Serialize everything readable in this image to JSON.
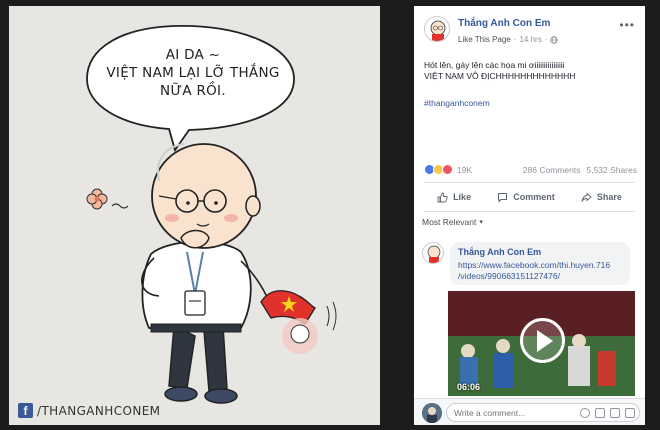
{
  "artwork": {
    "speech_lines": [
      "AI DA ~",
      "VIỆT NAM LẠI LỠ THẮNG",
      "NỮA RỒI."
    ],
    "watermark_logo": "f",
    "watermark_text": "/THANGANHCONEM"
  },
  "post": {
    "page_name": "Thắng Anh Con Em",
    "like_page": "Like This Page",
    "separator": "·",
    "time": "14 hrs",
    "separator2": "·",
    "more": "•••",
    "text_line1": "Hót lên, gáy lên các họa mi ơiiiiiiiiiiiiiiii",
    "text_line2": "VIỆT NAM VÔ ĐỊCHHHHHHHHHHHHH",
    "hashtag": "#thanganhconem",
    "reactions_count": "19K",
    "comments_count": "286 Comments",
    "shares_count": "5,532 Shares",
    "actions": {
      "like": "Like",
      "comment": "Comment",
      "share": "Share"
    },
    "sort_label": "Most Relevant",
    "comment": {
      "author": "Thắng Anh Con Em",
      "link_line1": "https://www.facebook.com/thi.huyen.716",
      "link_line2": "/videos/990663151127476/"
    },
    "video_duration": "06:06",
    "composer_placeholder": "Write a comment..."
  }
}
